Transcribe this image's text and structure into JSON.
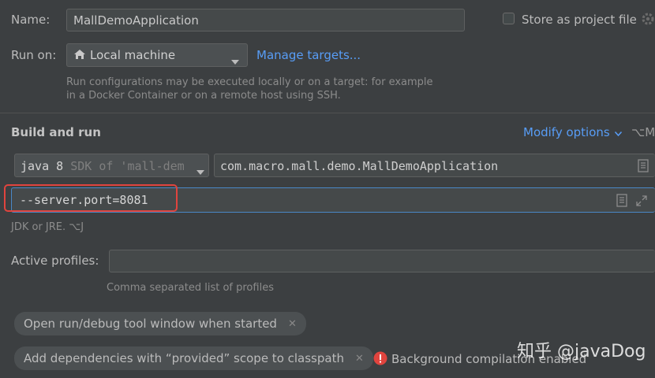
{
  "form": {
    "name_label": "Name:",
    "name_value": "MallDemoApplication",
    "store_label": "Store as project file",
    "run_on_label": "Run on:",
    "run_on_value": "Local machine",
    "manage_targets": "Manage targets...",
    "run_on_hint_line1": "Run configurations may be executed locally or on a target: for example",
    "run_on_hint_line2": "in a Docker Container or on a remote host using SSH."
  },
  "build_run": {
    "title": "Build and run",
    "modify_options": "Modify options",
    "modify_shortcut": "⌥M",
    "sdk_java": "java 8",
    "sdk_rest": "SDK of 'mall-dem",
    "main_class": "com.macro.mall.demo.MallDemoApplication",
    "program_args": "--server.port=8081",
    "jdk_hint": "JDK or JRE. ⌥J"
  },
  "profiles": {
    "label": "Active profiles:",
    "value": "",
    "hint": "Comma separated list of profiles"
  },
  "chips": {
    "open_tool_window": "Open run/debug tool window when started",
    "add_dependencies": "Add dependencies with “provided” scope to classpath",
    "background_compilation": "Background compilation enabled"
  },
  "watermark": "知乎 @javaDog",
  "colors": {
    "background": "#3c3f41",
    "link": "#589df6",
    "highlight_box": "#e0443e",
    "field_focus": "#4a88c7",
    "error": "#e0443e"
  }
}
